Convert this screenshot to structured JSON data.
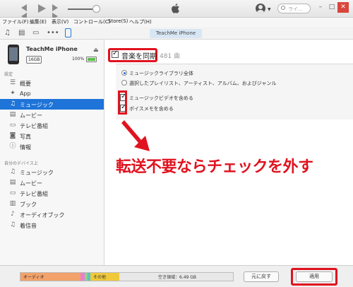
{
  "toolbar": {
    "search_placeholder": "ライ…",
    "icons": [
      "rewind-icon",
      "play-icon",
      "fast-forward-icon",
      "volume-slider",
      "apple-logo",
      "account-icon",
      "search-icon"
    ]
  },
  "menubar": {
    "items": [
      "ファイル(F)",
      "編集(E)",
      "表示(V)",
      "コントロール(C)",
      "Store(S)",
      "ヘルプ(H)"
    ]
  },
  "device_tab": "TeachMe iPhone",
  "sidebar": {
    "device_name": "TeachMe iPhone",
    "capacity": "16GB",
    "battery": "100%",
    "settings_title": "設定",
    "settings_items": [
      {
        "label": "概要",
        "icon": "summary-icon"
      },
      {
        "label": "App",
        "icon": "app-icon"
      },
      {
        "label": "ミュージック",
        "icon": "music-icon",
        "selected": true
      },
      {
        "label": "ムービー",
        "icon": "movie-icon"
      },
      {
        "label": "テレビ番組",
        "icon": "tv-icon"
      },
      {
        "label": "写真",
        "icon": "camera-icon"
      },
      {
        "label": "情報",
        "icon": "info-icon"
      }
    ],
    "ondevice_title": "自分のデバイス上",
    "ondevice_items": [
      {
        "label": "ミュージック",
        "icon": "music-icon"
      },
      {
        "label": "ムービー",
        "icon": "movie-icon"
      },
      {
        "label": "テレビ番組",
        "icon": "tv-icon"
      },
      {
        "label": "ブック",
        "icon": "book-icon"
      },
      {
        "label": "オーディオブック",
        "icon": "audiobook-icon"
      },
      {
        "label": "着信音",
        "icon": "bell-icon"
      }
    ]
  },
  "main": {
    "sync_label": "音楽を同期",
    "sync_checked": true,
    "count": "481 曲",
    "radio_options": [
      {
        "label": "ミュージックライブラリ全体",
        "checked": true
      },
      {
        "label": "選択したプレイリスト、アーティスト、アルバム、およびジャンル",
        "checked": false
      }
    ],
    "checkboxes": [
      {
        "label": "ミュージックビデオを含める",
        "checked": true
      },
      {
        "label": "ボイスメモを含める",
        "checked": true
      }
    ],
    "callout": "転送不要ならチェックを外す"
  },
  "bottom": {
    "capacity_segments": [
      {
        "label": "オーディオ",
        "color": "#f2a26a"
      },
      {
        "label": "",
        "color": "#e87fd0"
      },
      {
        "label": "",
        "color": "#8fd38a"
      },
      {
        "label": "",
        "color": "#58c4c4"
      },
      {
        "label": "その他",
        "color": "#f0c93a"
      },
      {
        "label": "空き領域：6.49 GB",
        "color": "#e8e8e8"
      }
    ],
    "revert_button": "元に戻す",
    "apply_button": "適用"
  },
  "colors": {
    "accent": "#1e74d8",
    "annotation": "#e0121f"
  }
}
